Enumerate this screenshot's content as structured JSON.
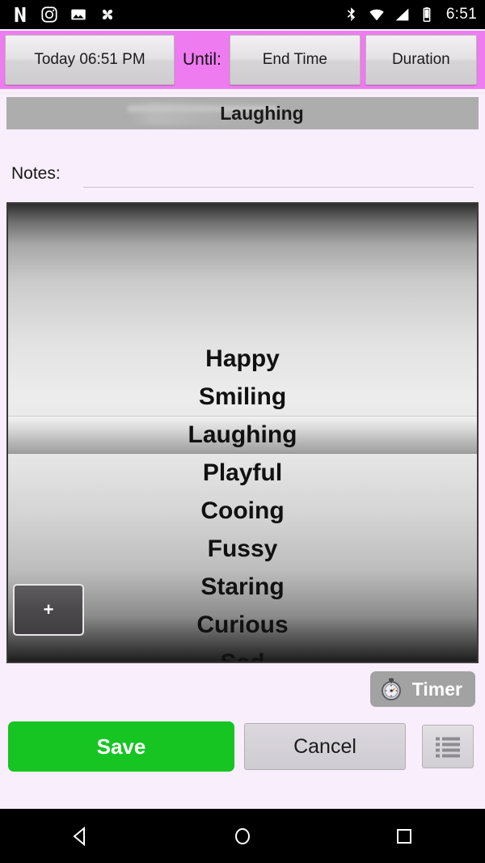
{
  "statusbar": {
    "time": "6:51",
    "left_icons": [
      "netflix-icon",
      "instagram-icon",
      "photos-icon",
      "pinwheel-icon"
    ],
    "right_icons": [
      "bluetooth-icon",
      "wifi-icon",
      "cellular-signal-icon",
      "battery-icon"
    ]
  },
  "timebar": {
    "start_time": "Today 06:51 PM",
    "until_label": "Until:",
    "end_time": "End Time",
    "duration": "Duration",
    "background_color": "#ee7cf0"
  },
  "title": {
    "text": "Laughing"
  },
  "notes": {
    "label": "Notes:",
    "value": "",
    "placeholder": ""
  },
  "picker": {
    "selected": "Laughing",
    "items": [
      "Happy",
      "Smiling",
      "Laughing",
      "Playful",
      "Cooing",
      "Fussy",
      "Staring",
      "Curious",
      "Sad"
    ],
    "add_label": "+"
  },
  "timer": {
    "label": "Timer"
  },
  "actions": {
    "save": "Save",
    "cancel": "Cancel",
    "save_color": "#16c422"
  },
  "navbar": {
    "back": "back-icon",
    "home": "home-icon",
    "recents": "recents-icon"
  }
}
